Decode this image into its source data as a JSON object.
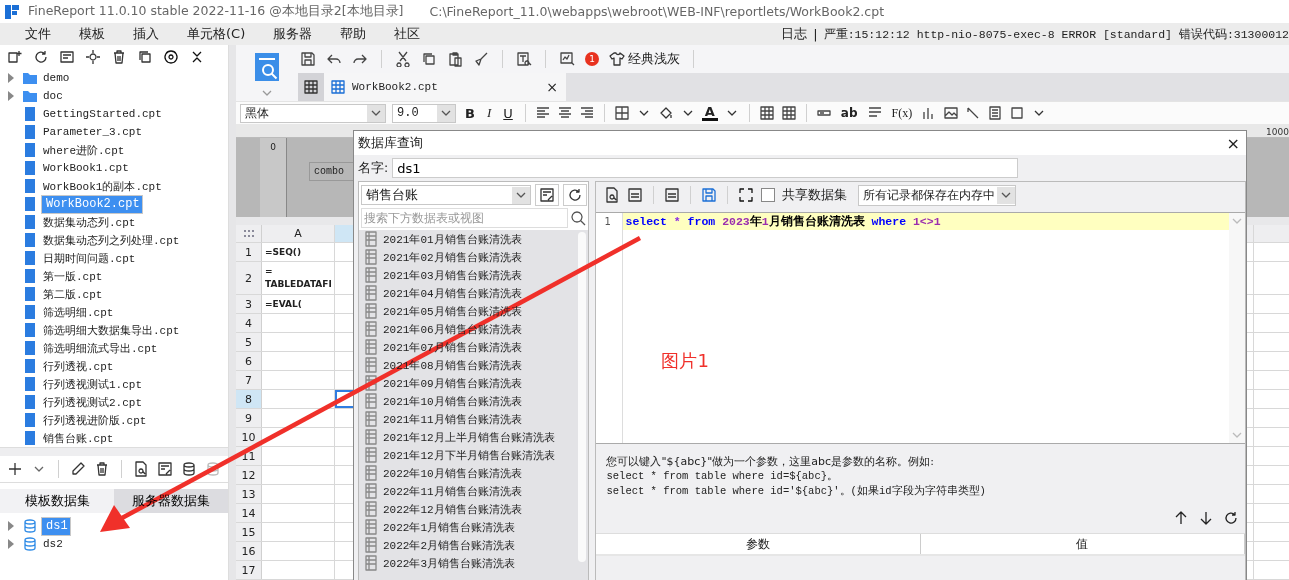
{
  "title_bar": {
    "title": "FineReport 11.0.10 stable 2022-11-16 @本地目录2[本地目录]",
    "path": "C:\\FineReport_11.0\\webapps\\webroot\\WEB-INF\\reportlets/WorkBook2.cpt"
  },
  "menu": [
    "文件",
    "模板",
    "插入",
    "单元格(C)",
    "服务器",
    "帮助",
    "社区"
  ],
  "log": {
    "label": "日志",
    "separator": "|",
    "message": "严重:15:12:12 http-nio-8075-exec-8 ERROR [standard] 错误代码:31300012"
  },
  "template_tree": [
    {
      "label": "demo",
      "kind": "folder",
      "selected": false
    },
    {
      "label": "doc",
      "kind": "folder",
      "selected": false
    },
    {
      "label": "GettingStarted.cpt",
      "kind": "file",
      "selected": false
    },
    {
      "label": "Parameter_3.cpt",
      "kind": "file",
      "selected": false
    },
    {
      "label": "where进阶.cpt",
      "kind": "file",
      "selected": false
    },
    {
      "label": "WorkBook1.cpt",
      "kind": "file",
      "selected": false
    },
    {
      "label": "WorkBook1的副本.cpt",
      "kind": "file",
      "selected": false
    },
    {
      "label": "WorkBook2.cpt",
      "kind": "file",
      "selected": true
    },
    {
      "label": "数据集动态列.cpt",
      "kind": "file",
      "selected": false
    },
    {
      "label": "数据集动态列之列处理.cpt",
      "kind": "file",
      "selected": false
    },
    {
      "label": "日期时间问题.cpt",
      "kind": "file",
      "selected": false
    },
    {
      "label": "第一版.cpt",
      "kind": "file",
      "selected": false
    },
    {
      "label": "第二版.cpt",
      "kind": "file",
      "selected": false
    },
    {
      "label": "筛选明细.cpt",
      "kind": "file",
      "selected": false
    },
    {
      "label": "筛选明细大数据集导出.cpt",
      "kind": "file",
      "selected": false
    },
    {
      "label": "筛选明细流式导出.cpt",
      "kind": "file",
      "selected": false
    },
    {
      "label": "行列透视.cpt",
      "kind": "file",
      "selected": false
    },
    {
      "label": "行列透视测试1.cpt",
      "kind": "file",
      "selected": false
    },
    {
      "label": "行列透视测试2.cpt",
      "kind": "file",
      "selected": false
    },
    {
      "label": "行列透视进阶版.cpt",
      "kind": "file",
      "selected": false
    },
    {
      "label": "销售台账.cpt",
      "kind": "file",
      "selected": false
    }
  ],
  "dataset_tabs": [
    {
      "label": "模板数据集",
      "selected": true
    },
    {
      "label": "服务器数据集",
      "selected": false
    }
  ],
  "datasets": [
    {
      "label": "ds1",
      "selected": true
    },
    {
      "label": "ds2",
      "selected": false
    }
  ],
  "toolbar": {
    "badge": "1",
    "theme": "经典浅灰"
  },
  "doc_tab": {
    "label": "WorkBook2.cpt",
    "close": "×"
  },
  "format_bar": {
    "font": "黑体",
    "size": "9.0",
    "bold": "B",
    "italic": "I",
    "underline": "U",
    "font_color": "A",
    "wrap": "ab",
    "formula": "F(x)"
  },
  "ruler": {
    "label": "1000"
  },
  "design": {
    "origin": "0",
    "widget": "combo"
  },
  "sheet": {
    "columns": [
      "A"
    ],
    "rows": [
      {
        "header": "1",
        "cell": "=SEQ()",
        "selected": false
      },
      {
        "header": "2",
        "cell": "=\nTABLEDATAFI",
        "selected": false
      },
      {
        "header": "3",
        "cell": "=EVAL(",
        "selected": false
      },
      {
        "header": "4",
        "selected": false
      },
      {
        "header": "5",
        "selected": false
      },
      {
        "header": "6",
        "selected": false
      },
      {
        "header": "7",
        "selected": false
      },
      {
        "header": "8",
        "selected": true
      },
      {
        "header": "9",
        "selected": false
      },
      {
        "header": "10",
        "selected": false
      },
      {
        "header": "11",
        "selected": false
      },
      {
        "header": "12",
        "selected": false
      },
      {
        "header": "13",
        "selected": false
      },
      {
        "header": "14",
        "selected": false
      },
      {
        "header": "15",
        "selected": false
      },
      {
        "header": "16",
        "selected": false
      },
      {
        "header": "17",
        "selected": false
      }
    ]
  },
  "dialog": {
    "title": "数据库查询",
    "close": "×",
    "name_label": "名字:",
    "name_value": "ds1",
    "connection": "销售台账",
    "search_placeholder": "搜索下方数据表或视图",
    "tables": [
      "2021年01月销售台账清洗表",
      "2021年02月销售台账清洗表",
      "2021年03月销售台账清洗表",
      "2021年04月销售台账清洗表",
      "2021年05月销售台账清洗表",
      "2021年06月销售台账清洗表",
      "2021年07月销售台账清洗表",
      "2021年08月销售台账清洗表",
      "2021年09月销售台账清洗表",
      "2021年10月销售台账清洗表",
      "2021年11月销售台账清洗表",
      "2021年12月上半月销售台账清洗表",
      "2021年12月下半月销售台账清洗表",
      "2022年10月销售台账清洗表",
      "2022年11月销售台账清洗表",
      "2022年12月销售台账清洗表",
      "2022年1月销售台账清洗表",
      "2022年2月销售台账清洗表",
      "2022年3月销售台账清洗表"
    ],
    "share_label": "共享数据集",
    "share_checked": false,
    "storage": "所有记录都保存在内存中",
    "sql": {
      "line_number": "1",
      "tokens": [
        {
          "text": "select ",
          "kind": "keyword"
        },
        {
          "text": "* ",
          "kind": "operator"
        },
        {
          "text": "from ",
          "kind": "keyword"
        },
        {
          "text": "2023",
          "kind": "number"
        },
        {
          "text": "年",
          "kind": "text"
        },
        {
          "text": "1",
          "kind": "number"
        },
        {
          "text": "月销售台账清洗表 ",
          "kind": "text"
        },
        {
          "text": "where ",
          "kind": "keyword"
        },
        {
          "text": "1<>1",
          "kind": "number"
        }
      ]
    },
    "hint": [
      "您可以键入\"${abc}\"做为一个参数，这里abc是参数的名称。例如:",
      "select * from table where id=${abc}。",
      "select * from table where id='${abc}'。(如果id字段为字符串类型)"
    ],
    "param_columns": [
      "参数",
      "值"
    ]
  },
  "annotation": {
    "label": "图片1"
  }
}
